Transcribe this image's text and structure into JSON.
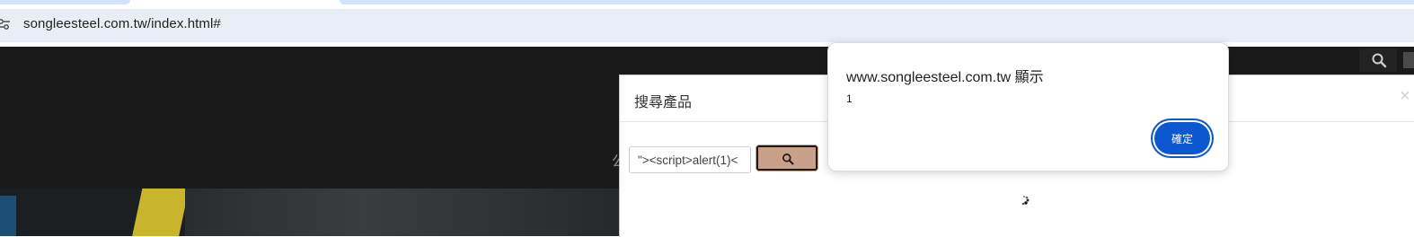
{
  "browser": {
    "url": "songleesteel.com.tw/index.html#",
    "site_info_icon": "tune-icon"
  },
  "page": {
    "header_search_icon": "search-icon",
    "hero_partial_char": "公"
  },
  "search_modal": {
    "title": "搜尋產品",
    "close_glyph": "×",
    "input_value": "\"><script>alert(1)<",
    "submit_icon": "search-icon",
    "submit_color": "#c8a08a",
    "loading_icon": "spinner-icon"
  },
  "alert_dialog": {
    "title": "www.songleesteel.com.tw 顯示",
    "message": "1",
    "ok_label": "確定",
    "ok_color": "#0b57d0"
  }
}
